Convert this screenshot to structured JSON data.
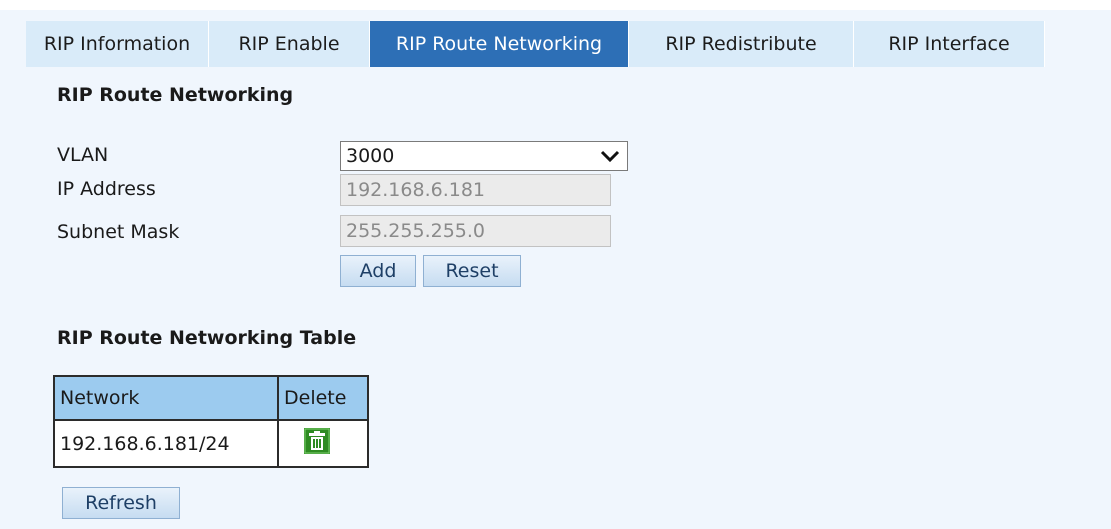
{
  "tabs": [
    {
      "label": "RIP Information"
    },
    {
      "label": "RIP Enable"
    },
    {
      "label": "RIP Route Networking"
    },
    {
      "label": "RIP Redistribute"
    },
    {
      "label": "RIP Interface"
    }
  ],
  "active_tab": "RIP Route Networking",
  "form": {
    "title": "RIP Route Networking",
    "vlan_label": "VLAN",
    "vlan_value": "3000",
    "ip_label": "IP Address",
    "ip_value": "192.168.6.181",
    "mask_label": "Subnet Mask",
    "mask_value": "255.255.255.0",
    "add_label": "Add",
    "reset_label": "Reset"
  },
  "table": {
    "title": "RIP Route Networking Table",
    "headers": [
      "Network",
      "Delete"
    ],
    "rows": [
      {
        "network": "192.168.6.181/24",
        "delete_icon": "trash-icon"
      }
    ],
    "refresh_label": "Refresh"
  },
  "colors": {
    "panel_bg": "#f0f6fd",
    "tab_bg": "#d9ebf9",
    "tab_active_bg": "#2d6fb6",
    "table_header_bg": "#9ccbef",
    "trash_icon": "#2e8b22"
  }
}
